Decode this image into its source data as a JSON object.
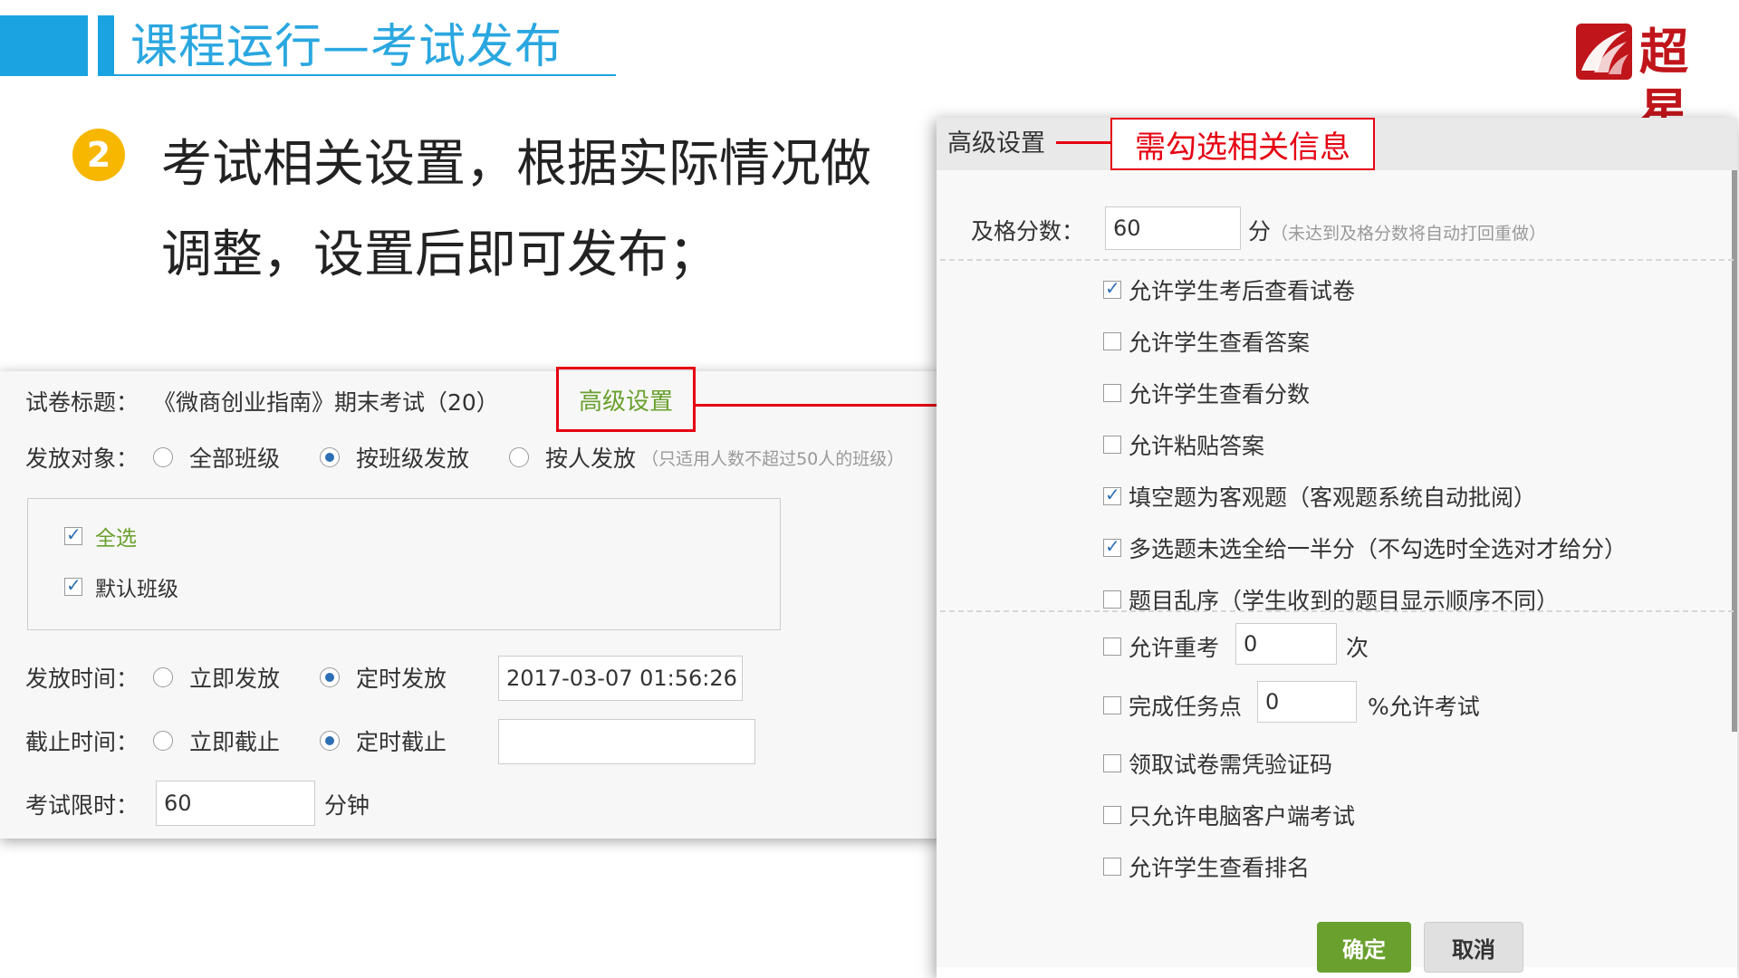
{
  "slide": {
    "title": "课程运行—考试发布",
    "logo_text": "超星",
    "bullet_number": "2",
    "bullet_line1": "考试相关设置，根据实际情况做",
    "bullet_line2": "调整，设置后即可发布；"
  },
  "form": {
    "paper_title_label": "试卷标题：",
    "paper_title_value": "《微商创业指南》期末考试（20）",
    "advanced_link": "高级设置",
    "target_label": "发放对象：",
    "target_options": [
      "全部班级",
      "按班级发放",
      "按人发放"
    ],
    "target_selected": "按班级发放",
    "target_hint": "（只适用人数不超过50人的班级）",
    "select_all": "全选",
    "default_class": "默认班级",
    "publish_time_label": "发放时间：",
    "publish_now": "立即发放",
    "publish_scheduled": "定时发放",
    "publish_time_value": "2017-03-07 01:56:26",
    "deadline_label": "截止时间：",
    "deadline_now": "立即截止",
    "deadline_scheduled": "定时截止",
    "deadline_value": "",
    "limit_label": "考试限时：",
    "limit_value": "60",
    "limit_unit": "分钟"
  },
  "dialog": {
    "title": "高级设置",
    "tip": "需勾选相关信息",
    "pass_score_label": "及格分数：",
    "pass_score_value": "60",
    "pass_score_unit": "分",
    "pass_score_hint": "（未达到及格分数将自动打回重做）",
    "options": [
      {
        "label": "允许学生考后查看试卷",
        "checked": true
      },
      {
        "label": "允许学生查看答案",
        "checked": false
      },
      {
        "label": "允许学生查看分数",
        "checked": false
      },
      {
        "label": "允许粘贴答案",
        "checked": false
      },
      {
        "label": "填空题为客观题（客观题系统自动批阅）",
        "checked": true
      },
      {
        "label": "多选题未选全给一半分（不勾选时全选对才给分）",
        "checked": true
      },
      {
        "label": "题目乱序（学生收到的题目显示顺序不同）",
        "checked": false
      }
    ],
    "retake_label": "允许重考",
    "retake_value": "0",
    "retake_unit": "次",
    "task_label": "完成任务点",
    "task_value": "0",
    "task_unit": "%允许考试",
    "options2": [
      {
        "label": "领取试卷需凭验证码",
        "checked": false
      },
      {
        "label": "只允许电脑客户端考试",
        "checked": false
      },
      {
        "label": "允许学生查看排名",
        "checked": false
      }
    ],
    "ok": "确定",
    "cancel": "取消"
  },
  "colors": {
    "brand_blue": "#1aa3e0",
    "accent_red": "#e60012",
    "green": "#6aa02d",
    "bullet_yellow": "#f7b700"
  }
}
